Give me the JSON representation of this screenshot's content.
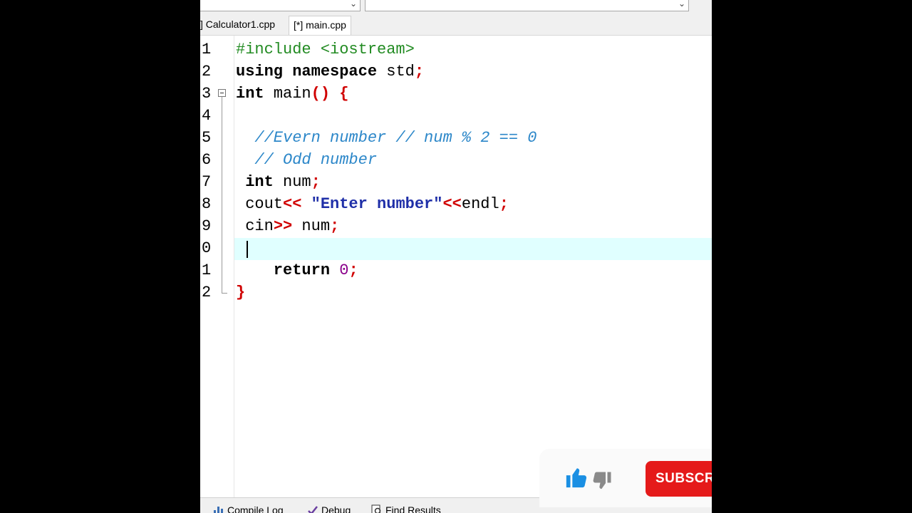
{
  "editor": {
    "tabs": [
      {
        "label": "] Calculator1.cpp",
        "active": false
      },
      {
        "label": "[*] main.cpp",
        "active": true
      }
    ],
    "line_numbers": [
      "1",
      "2",
      "3",
      "4",
      "5",
      "6",
      "7",
      "8",
      "9",
      "0",
      "1",
      "2"
    ],
    "code": {
      "l1_pre": "#include <iostream>",
      "l2_kw1": "using",
      "l2_kw2": "namespace",
      "l2_id": " std",
      "l2_semi": ";",
      "l3_kw": "int",
      "l3_id": " main",
      "l3_paren": "()",
      "l3_brace": " {",
      "l5_cmt": "  //Evern number // num % 2 == 0",
      "l6_cmt": "  // Odd number",
      "l7_kw": " int",
      "l7_id": " num",
      "l7_semi": ";",
      "l8_id": " cout",
      "l8_op": "<<",
      "l8_str": " \"Enter number\"",
      "l8_op2": "<<",
      "l8_id2": "endl",
      "l8_semi": ";",
      "l9_id": " cin",
      "l9_op": ">>",
      "l9_id2": " num",
      "l9_semi": ";",
      "l11_kw": "    return",
      "l11_num": " 0",
      "l11_semi": ";",
      "l12_brace": "}"
    },
    "current_line_index": 10
  },
  "bottom_tabs": [
    {
      "label": "Compile Log",
      "icon": "bar-chart-icon"
    },
    {
      "label": "Debug",
      "icon": "check-icon"
    },
    {
      "label": "Find Results",
      "icon": "find-icon"
    }
  ],
  "overlay": {
    "like_icon": "thumbs-up-icon",
    "dislike_icon": "thumbs-down-icon",
    "subscribe_label": "SUBSCRI"
  },
  "colors": {
    "keyword": "#000000",
    "preprocessor": "#228b22",
    "comment": "#2c87c9",
    "string": "#1f2fa8",
    "operator": "#d00000",
    "number": "#8b008b",
    "current_line": "#e0ffff",
    "subscribe": "#e51a1a",
    "like": "#1a8fe3"
  }
}
